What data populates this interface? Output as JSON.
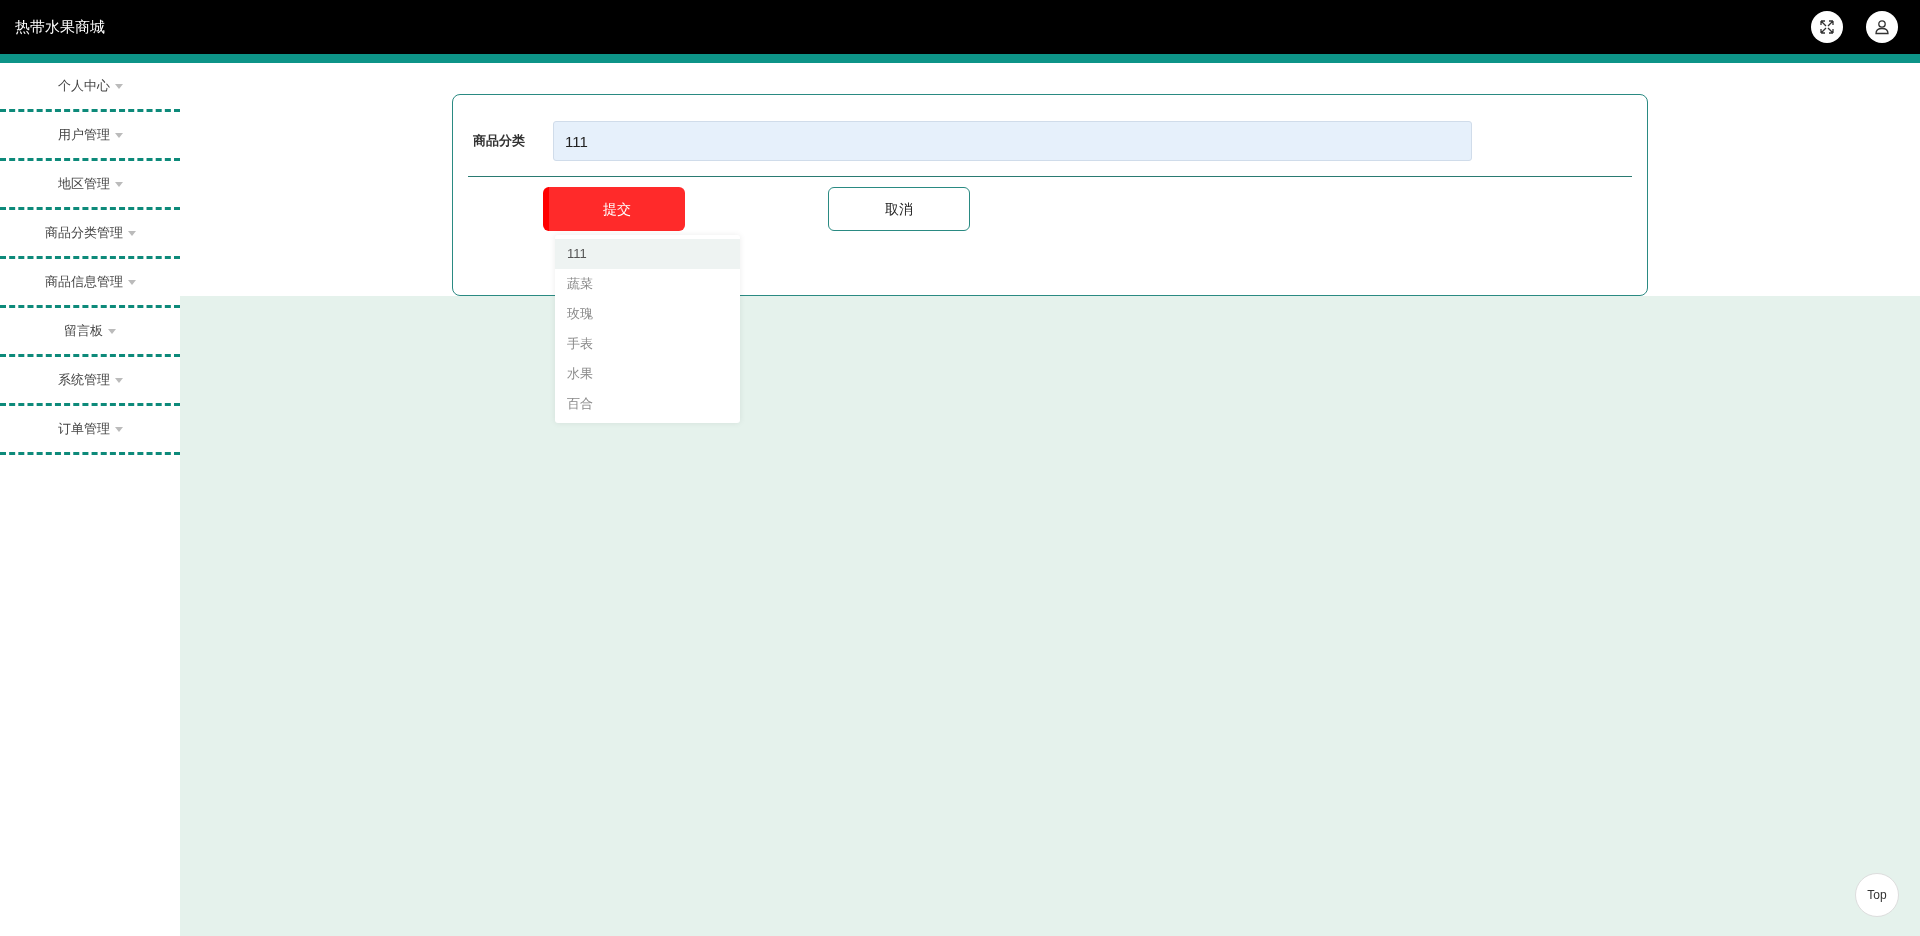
{
  "header": {
    "title": "热带水果商城"
  },
  "sidebar": {
    "items": [
      {
        "label": "个人中心"
      },
      {
        "label": "用户管理"
      },
      {
        "label": "地区管理"
      },
      {
        "label": "商品分类管理"
      },
      {
        "label": "商品信息管理"
      },
      {
        "label": "留言板"
      },
      {
        "label": "系统管理"
      },
      {
        "label": "订单管理"
      }
    ]
  },
  "form": {
    "field": {
      "label": "商品分类",
      "value": "111"
    },
    "suggestions": [
      {
        "label": "111",
        "selected": true
      },
      {
        "label": "蔬菜",
        "selected": false
      },
      {
        "label": "玫瑰",
        "selected": false
      },
      {
        "label": "手表",
        "selected": false
      },
      {
        "label": "水果",
        "selected": false
      },
      {
        "label": "百合",
        "selected": false
      }
    ],
    "buttons": [
      {
        "label": "提交",
        "kind": "primary"
      },
      {
        "label": "取消",
        "kind": "secondary"
      }
    ]
  },
  "back_to_top": {
    "label": "Top"
  }
}
